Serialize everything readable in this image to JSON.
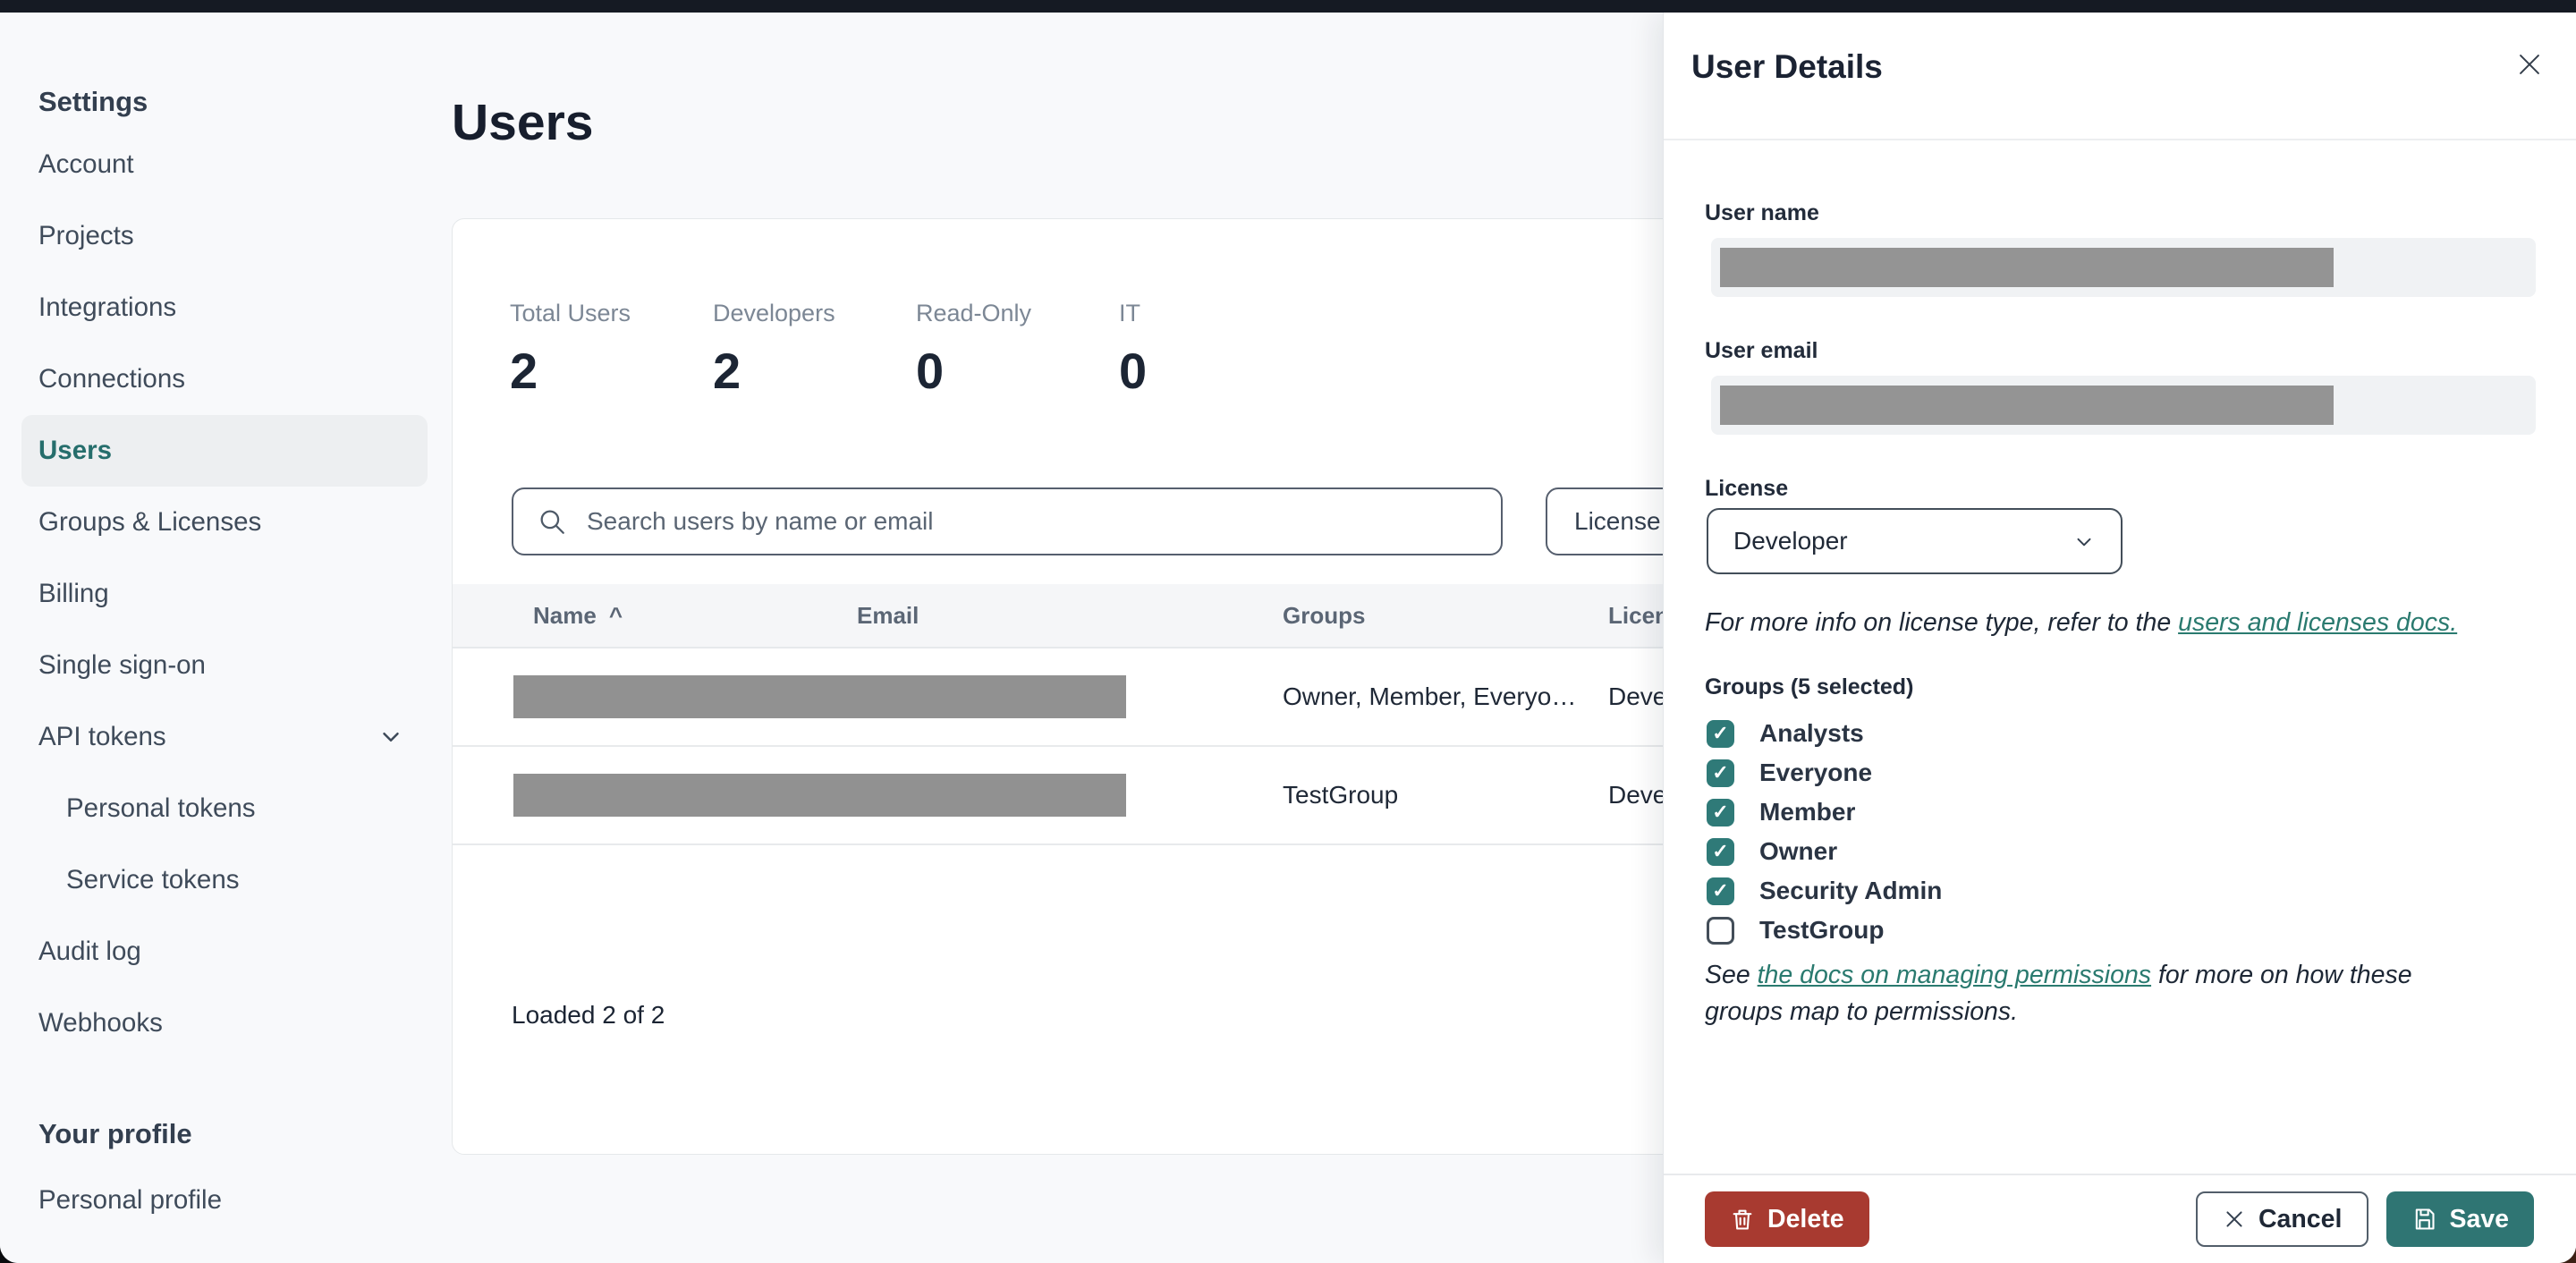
{
  "sidebar": {
    "title": "Settings",
    "items": [
      {
        "label": "Account"
      },
      {
        "label": "Projects"
      },
      {
        "label": "Integrations"
      },
      {
        "label": "Connections"
      },
      {
        "label": "Users",
        "active": true
      },
      {
        "label": "Groups & Licenses"
      },
      {
        "label": "Billing"
      },
      {
        "label": "Single sign-on"
      },
      {
        "label": "API tokens",
        "expandable": true
      },
      {
        "label": "Personal tokens",
        "sub": true
      },
      {
        "label": "Service tokens",
        "sub": true
      },
      {
        "label": "Audit log"
      },
      {
        "label": "Webhooks"
      }
    ],
    "profile_title": "Your profile",
    "profile_items": [
      {
        "label": "Personal profile"
      }
    ]
  },
  "main": {
    "page_title": "Users",
    "stats": [
      {
        "label": "Total Users",
        "value": "2"
      },
      {
        "label": "Developers",
        "value": "2"
      },
      {
        "label": "Read-Only",
        "value": "0"
      },
      {
        "label": "IT",
        "value": "0"
      }
    ],
    "search": {
      "placeholder": "Search users by name or email"
    },
    "license_filter_label": "License",
    "table": {
      "columns": [
        {
          "label": "Name",
          "sort": "asc",
          "sort_glyph": "^"
        },
        {
          "label": "Email"
        },
        {
          "label": "Groups"
        },
        {
          "label": "License"
        }
      ],
      "rows": [
        {
          "name_redacted": true,
          "email_redacted": true,
          "groups": "Owner, Member, Everyo…",
          "license": "Developer"
        },
        {
          "name_redacted": true,
          "email_redacted": true,
          "groups": "TestGroup",
          "license": "Developer"
        }
      ]
    },
    "status": "Loaded 2 of 2"
  },
  "drawer": {
    "title": "User Details",
    "user_name_label": "User name",
    "user_email_label": "User email",
    "license_label": "License",
    "license_value": "Developer",
    "license_note_prefix": "For more info on license type, refer to the ",
    "license_note_link": "users and licenses docs.",
    "groups_label": "Groups (5 selected)",
    "groups": [
      {
        "name": "Analysts",
        "checked": true
      },
      {
        "name": "Everyone",
        "checked": true
      },
      {
        "name": "Member",
        "checked": true
      },
      {
        "name": "Owner",
        "checked": true
      },
      {
        "name": "Security Admin",
        "checked": true
      },
      {
        "name": "TestGroup",
        "checked": false
      }
    ],
    "permissions_note_prefix": "See ",
    "permissions_note_link": "the docs on managing permissions",
    "permissions_note_suffix": " for more on how these groups map to permissions.",
    "delete_label": "Delete",
    "cancel_label": "Cancel",
    "save_label": "Save"
  },
  "colors": {
    "topbar": "#151a23",
    "accent_teal": "#2f7a78",
    "sidebar_selected_teal": "#266e6c",
    "link_teal": "#2a7a6f",
    "delete_red": "#a83a30",
    "save_teal": "#2f7573",
    "redaction_gray": "#949494",
    "page_background": "#f8f9fb"
  }
}
